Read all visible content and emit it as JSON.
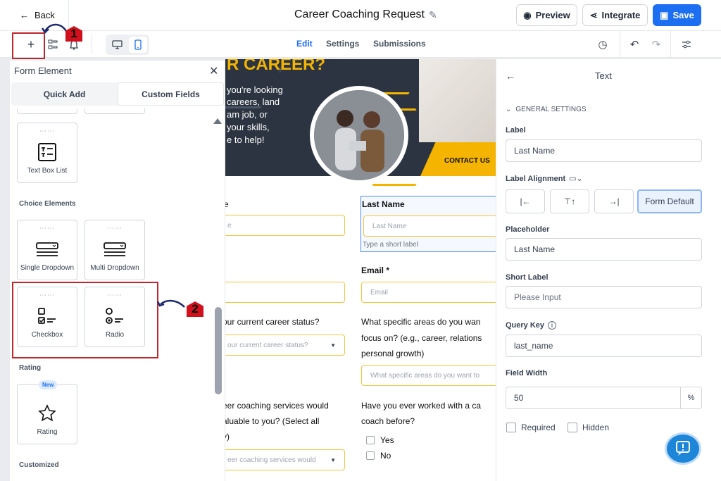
{
  "header": {
    "back_label": "Back",
    "title": "Career Coaching Request",
    "preview_label": "Preview",
    "integrate_label": "Integrate",
    "save_label": "Save"
  },
  "nav": {
    "tabs": [
      "Edit",
      "Settings",
      "Submissions"
    ],
    "active_tab": "Edit"
  },
  "callouts": {
    "one": "1",
    "two": "2"
  },
  "left_panel": {
    "heading": "Form Element",
    "tabs": [
      "Quick Add",
      "Custom Fields"
    ],
    "active_tab": "Custom Fields",
    "text_box_list": "Text Box List",
    "choice_section": "Choice Elements",
    "choice_items": [
      "Single Dropdown",
      "Multi Dropdown",
      "Checkbox",
      "Radio"
    ],
    "rating_section": "Rating",
    "rating_badge": "New",
    "rating_item": "Rating",
    "customized_section": "Customized"
  },
  "canvas": {
    "banner_heading": "R CAREER?",
    "banner_lines": [
      "you're looking",
      "careers, land",
      "am job, or",
      "your skills,",
      "e to help!"
    ],
    "contact_label": "CONTACT US",
    "fields": {
      "first_label": "e",
      "first_placeholder": "e",
      "last_label": "Last Name",
      "last_placeholder": "Last Name",
      "last_hint": "Type a short label",
      "email_label": "Email *",
      "email_placeholder": "Email",
      "status_label": "our current career status?",
      "status_placeholder": "our current career status?",
      "areas_label_1": "What specific areas do you wan",
      "areas_label_2": "focus on? (e.g., career, relations",
      "areas_label_3": "personal growth)",
      "areas_placeholder": "What specific areas do you want to",
      "services_label_1": "eer coaching services would",
      "services_label_2": "aluable to you? (Select all",
      "services_label_3": "y)",
      "services_placeholder": "eer coaching services would",
      "worked_label_1": "Have you ever worked with a ca",
      "worked_label_2": "coach before?",
      "options": [
        "Yes",
        "No"
      ]
    }
  },
  "right_panel": {
    "title": "Text",
    "section": "GENERAL SETTINGS",
    "label_label": "Label",
    "label_value": "Last Name",
    "alignment_label": "Label Alignment",
    "alignment_default": "Form Default",
    "placeholder_label": "Placeholder",
    "placeholder_value": "Last Name",
    "short_label_label": "Short Label",
    "short_label_placeholder": "Please Input",
    "query_key_label": "Query Key",
    "query_key_value": "last_name",
    "field_width_label": "Field Width",
    "field_width_value": "50",
    "field_width_unit": "%",
    "required_label": "Required",
    "hidden_label": "Hidden"
  },
  "colors": {
    "accent": "#1d6ff2",
    "highlight": "#f4b400",
    "callout": "#d0101d"
  }
}
